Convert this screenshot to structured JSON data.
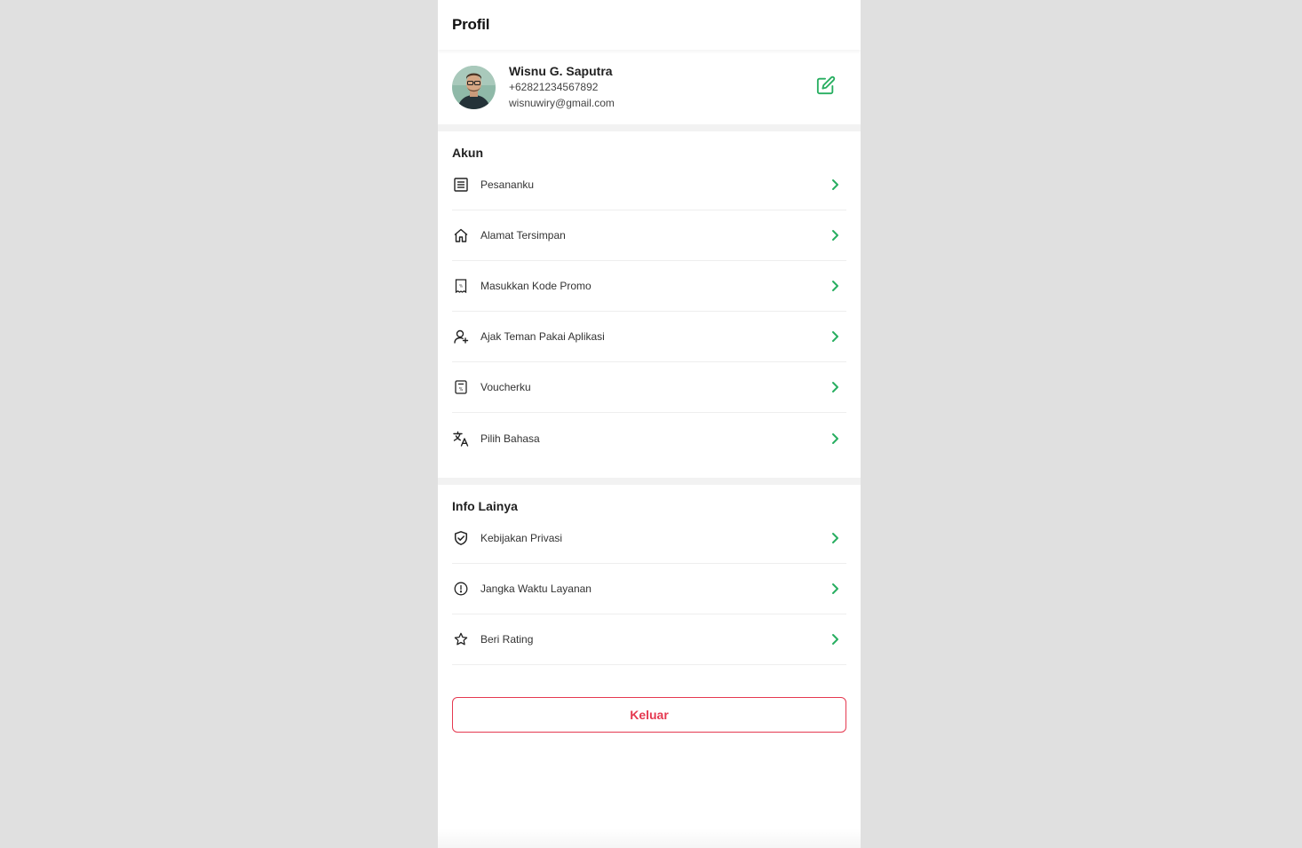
{
  "header": {
    "title": "Profil"
  },
  "profile": {
    "name": "Wisnu G. Saputra",
    "phone": "+62821234567892",
    "email": "wisnuwiry@gmail.com",
    "edit_icon": "edit-icon"
  },
  "akun": {
    "title": "Akun",
    "items": [
      {
        "label": "Pesananku",
        "icon": "list-icon"
      },
      {
        "label": "Alamat Tersimpan",
        "icon": "home-icon"
      },
      {
        "label": "Masukkan Kode Promo",
        "icon": "promo-icon"
      },
      {
        "label": "Ajak Teman Pakai Aplikasi",
        "icon": "invite-friend-icon"
      },
      {
        "label": "Voucherku",
        "icon": "voucher-icon"
      },
      {
        "label": "Pilih Bahasa",
        "icon": "translate-icon"
      }
    ]
  },
  "info": {
    "title": "Info Lainya",
    "items": [
      {
        "label": "Kebijakan Privasi",
        "icon": "shield-check-icon"
      },
      {
        "label": "Jangka Waktu Layanan",
        "icon": "info-icon"
      },
      {
        "label": "Beri Rating",
        "icon": "star-icon"
      }
    ]
  },
  "logout": {
    "label": "Keluar"
  },
  "colors": {
    "accent": "#27ae60",
    "danger": "#e53950",
    "background": "#e0e0e0"
  }
}
